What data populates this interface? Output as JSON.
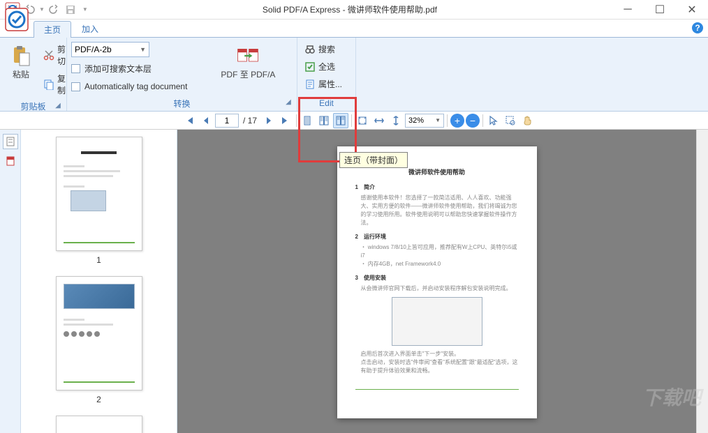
{
  "app": {
    "title": "Solid PDF/A Express - 微讲师软件使用帮助.pdf"
  },
  "tabs": {
    "home": "主页",
    "insert": "加入"
  },
  "ribbon": {
    "clipboard": {
      "label": "剪贴板",
      "paste": "粘贴",
      "cut": "剪切",
      "copy": "复制"
    },
    "convert": {
      "label": "转换",
      "pdfa_combo": "PDF/A-2b",
      "chk_searchable": "添加可搜索文本层",
      "chk_autotag": "Automatically tag document",
      "pdf_to_pdfa": "PDF 至 PDF/A"
    },
    "edit": {
      "label": "Edit",
      "search": "搜索",
      "select_all": "全选",
      "properties": "属性..."
    }
  },
  "toolbar": {
    "page_current": "1",
    "page_total": "/ 17",
    "zoom": "32%"
  },
  "tooltip": {
    "facing_cover": "连页（带封面）"
  },
  "thumbs": {
    "p1": "1",
    "p2": "2"
  },
  "document": {
    "title": "微讲师软件使用帮助",
    "s1_title": "1　简介",
    "s1_text": "感谢使用本软件！您选择了一款简洁适用、人人喜欢、功能强大、实用方便的软件——微讲师软件使用帮助，我们将竭诚为您的学习使用所用。软件使用说明可以帮助您快速掌握软件操作方法。",
    "s2_title": "2　运行环境",
    "s2_bullet1": "・ windows 7/8/10上皆可应用，推荐配有W上CPU、英特尔i5或i7",
    "s2_bullet2": "・ 内存4GB，net Framework4.0",
    "s3_title": "3　使用安装",
    "s3_text": "从会微讲师官网下载后，并启动安装程序解包安装说明完成。",
    "s3_text2": "启用后首次进入界面单击\"下一步\"安装。",
    "s3_text3": "点击启动，安装时选\"件审阅\"查看\"系统配置\"跟\"最适配\"选项，这有助于提升体验效果和流畅。"
  },
  "watermark": "下载吧"
}
